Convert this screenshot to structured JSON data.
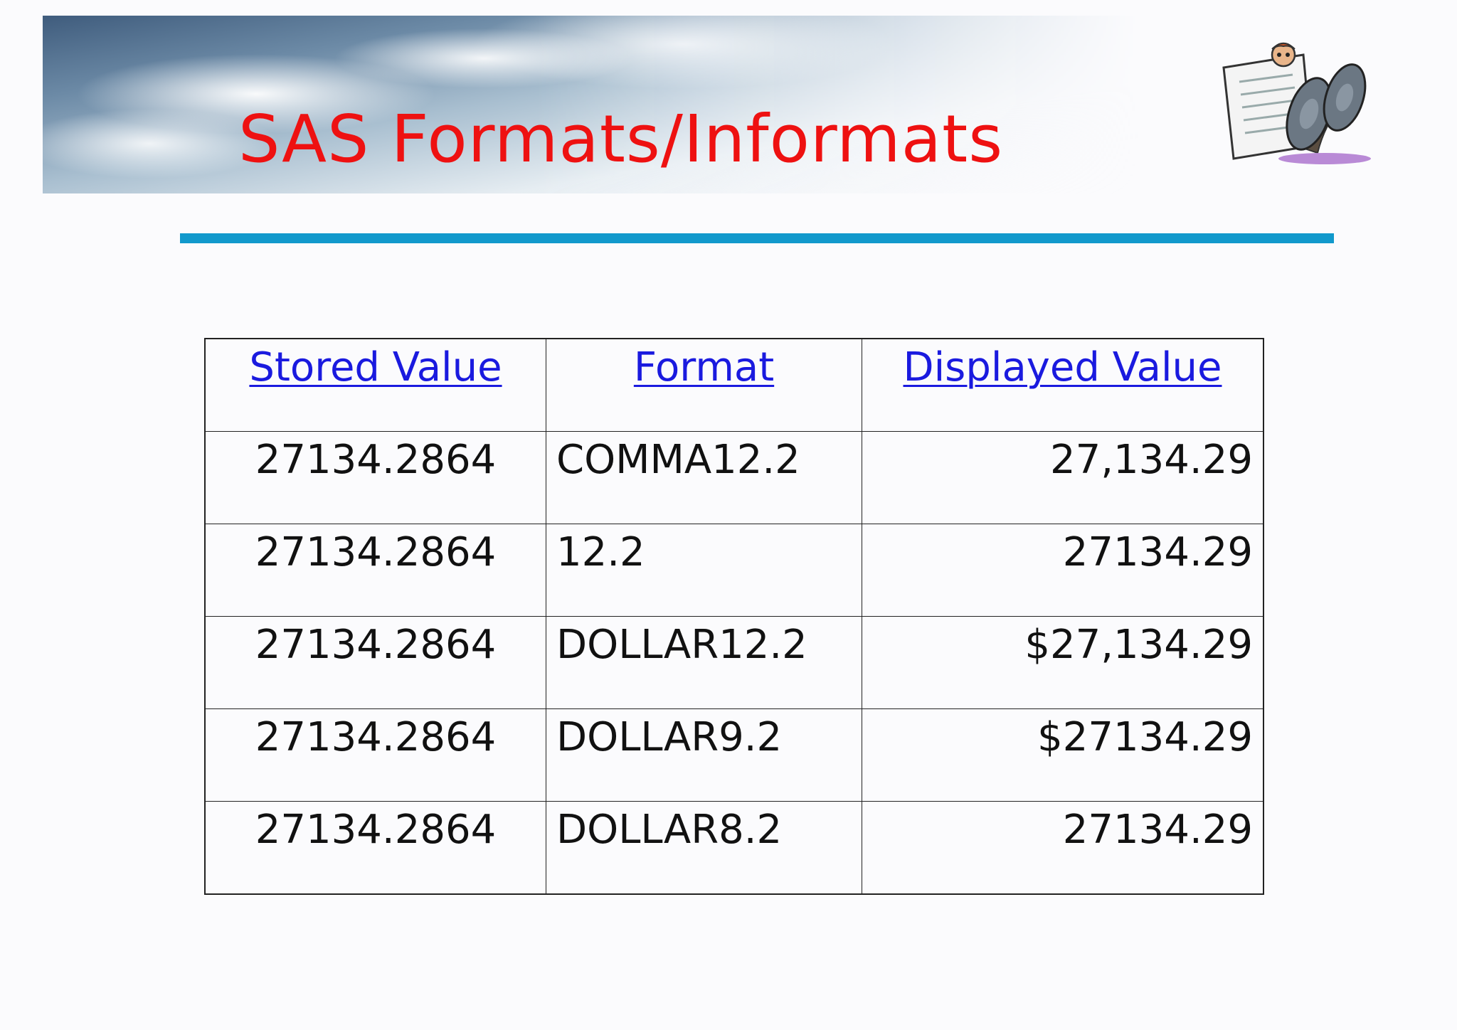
{
  "slide": {
    "title": "SAS Formats/Informats"
  },
  "table": {
    "headers": [
      "Stored Value",
      "Format",
      "Displayed Value"
    ],
    "rows": [
      [
        "27134.2864",
        "COMMA12.2",
        "27,134.29"
      ],
      [
        "27134.2864",
        "12.2",
        "27134.29"
      ],
      [
        "27134.2864",
        "DOLLAR12.2",
        "$27,134.29"
      ],
      [
        "27134.2864",
        "DOLLAR9.2",
        "$27134.29"
      ],
      [
        "27134.2864",
        "DOLLAR8.2",
        "27134.29"
      ]
    ]
  },
  "colors": {
    "title": "#ee1111",
    "rule": "#1199cc",
    "header_link": "#1a1adf"
  },
  "icons": {
    "header_background": "cloud-sky-banner",
    "clipart": "man-reading-newspaper-clipart"
  }
}
